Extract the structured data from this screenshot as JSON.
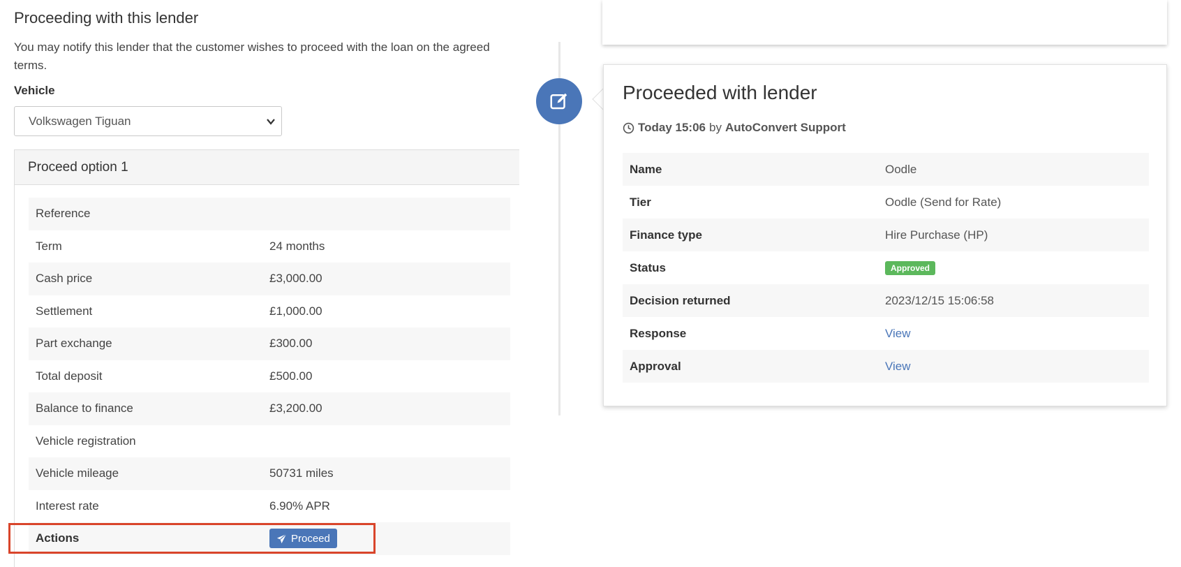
{
  "left": {
    "title": "Proceeding with this lender",
    "intro": "You may notify this lender that the customer wishes to proceed with the loan on the agreed terms.",
    "vehicle_label": "Vehicle",
    "vehicle_selected": "Volkswagen Tiguan",
    "panel_heading": "Proceed option 1",
    "rows": [
      {
        "label": "Reference",
        "value": ""
      },
      {
        "label": "Term",
        "value": "24 months"
      },
      {
        "label": "Cash price",
        "value": "£3,000.00"
      },
      {
        "label": "Settlement",
        "value": "£1,000.00"
      },
      {
        "label": "Part exchange",
        "value": "£300.00"
      },
      {
        "label": "Total deposit",
        "value": "£500.00"
      },
      {
        "label": "Balance to finance",
        "value": "£3,200.00"
      },
      {
        "label": "Vehicle registration",
        "value": ""
      },
      {
        "label": "Vehicle mileage",
        "value": "50731 miles"
      },
      {
        "label": "Interest rate",
        "value": "6.90% APR"
      }
    ],
    "actions_label": "Actions",
    "proceed_label": "Proceed"
  },
  "card": {
    "title": "Proceeded with lender",
    "time": "Today 15:06",
    "by": "by",
    "user": "AutoConvert Support",
    "rows": [
      {
        "label": "Name",
        "value": "Oodle"
      },
      {
        "label": "Tier",
        "value": "Oodle (Send for Rate)"
      },
      {
        "label": "Finance type",
        "value": "Hire Purchase (HP)"
      },
      {
        "label": "Status",
        "value": "Approved"
      },
      {
        "label": "Decision returned",
        "value": "2023/12/15 15:06:58"
      },
      {
        "label": "Response",
        "value": "View"
      },
      {
        "label": "Approval",
        "value": "View"
      }
    ]
  },
  "colors": {
    "accent": "#4a76b8",
    "approved": "#5cb85c",
    "highlight": "#d9452b"
  }
}
